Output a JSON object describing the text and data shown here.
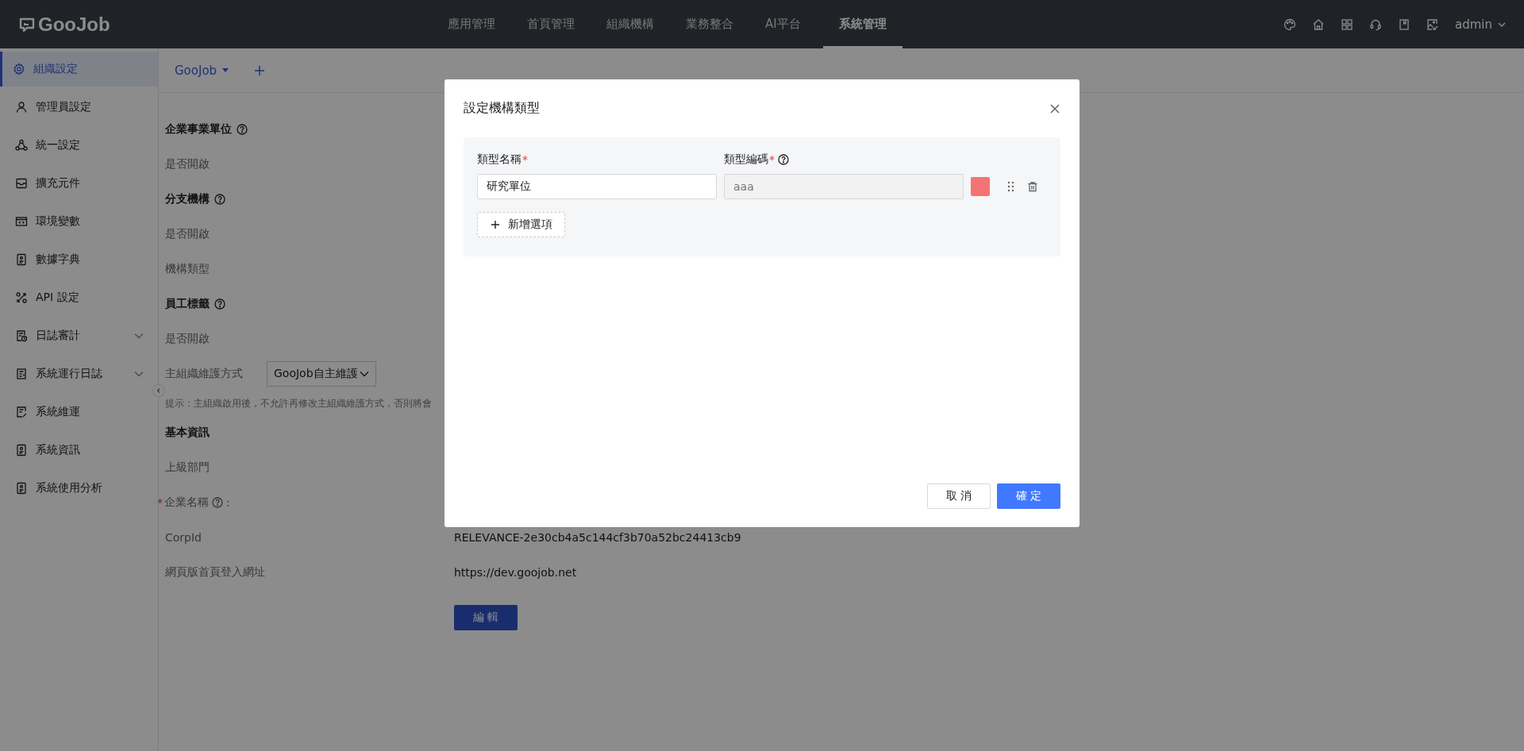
{
  "topbar": {
    "logo": "GooJob",
    "nav": [
      {
        "label": "應用管理",
        "selected": false
      },
      {
        "label": "首頁管理",
        "selected": false
      },
      {
        "label": "組織機構",
        "selected": false
      },
      {
        "label": "業務整合",
        "selected": false
      },
      {
        "label": "AI平台",
        "selected": false
      },
      {
        "label": "系統管理",
        "selected": true
      }
    ],
    "user": "admin"
  },
  "sidebar": {
    "items": [
      {
        "label": "組織設定",
        "selected": true,
        "expandable": false
      },
      {
        "label": "管理員設定",
        "selected": false,
        "expandable": false
      },
      {
        "label": "統一設定",
        "selected": false,
        "expandable": false
      },
      {
        "label": "擴充元件",
        "selected": false,
        "expandable": false
      },
      {
        "label": "環境變數",
        "selected": false,
        "expandable": false
      },
      {
        "label": "數據字典",
        "selected": false,
        "expandable": false
      },
      {
        "label": "API 設定",
        "selected": false,
        "expandable": false
      },
      {
        "label": "日誌審計",
        "selected": false,
        "expandable": true
      },
      {
        "label": "系統運行日誌",
        "selected": false,
        "expandable": true
      },
      {
        "label": "系統維運",
        "selected": false,
        "expandable": false
      },
      {
        "label": "系統資訊",
        "selected": false,
        "expandable": false
      },
      {
        "label": "系統使用分析",
        "selected": false,
        "expandable": false
      }
    ]
  },
  "org_tab": {
    "label": "GooJob"
  },
  "rows": [
    {
      "kind": "heading",
      "label": "企業事業單位",
      "help": true
    },
    {
      "kind": "field",
      "label": "是否開啟"
    },
    {
      "kind": "heading",
      "label": "分支機構",
      "help": true
    },
    {
      "kind": "field",
      "label": "是否開啟"
    },
    {
      "kind": "field",
      "label": "機構類型"
    },
    {
      "kind": "heading",
      "label": "員工標籤",
      "help": true
    },
    {
      "kind": "field",
      "label": "是否開啟"
    },
    {
      "kind": "select",
      "label": "主組織維護方式",
      "value": "GooJob自主維護"
    },
    {
      "kind": "hint",
      "label": "提示：主組織啟用後，不允許再修改主組織維護方式，否則將會"
    },
    {
      "kind": "heading",
      "label": "基本資訊",
      "help": false
    },
    {
      "kind": "field",
      "label": "上級部門"
    },
    {
      "kind": "field",
      "label": "企業名稱",
      "required_mark": "*",
      "help": true,
      "suffix": ":"
    },
    {
      "kind": "field",
      "label": "CorpId",
      "value": "RELEVANCE-2e30cb4a5c144cf3b70a52bc24413cb9"
    },
    {
      "kind": "field",
      "label": "網頁版首頁登入網址",
      "value": "https://dev.goojob.net"
    },
    {
      "kind": "button",
      "label": "編 輯"
    }
  ],
  "modal": {
    "title": "設定機構類型",
    "columns": [
      {
        "label": "類型名稱",
        "required_mark": "*",
        "help": false
      },
      {
        "label": "類型編碼",
        "required_mark": "*",
        "help": true
      }
    ],
    "options": [
      {
        "name": "研究單位",
        "code_placeholder": "aaa",
        "color": "#f47474"
      }
    ],
    "add_button": "新增選項",
    "cancel": "取 消",
    "ok": "確 定"
  }
}
